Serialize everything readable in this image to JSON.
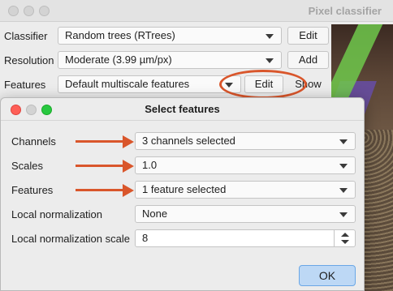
{
  "main": {
    "title": "Pixel classifier",
    "classifier": {
      "label": "Classifier",
      "value": "Random trees (RTrees)",
      "button": "Edit"
    },
    "resolution": {
      "label": "Resolution",
      "value": "Moderate (3.99 µm/px)",
      "button": "Add"
    },
    "features": {
      "label": "Features",
      "value": "Default multiscale features",
      "button": "Edit",
      "extra_button": "Show"
    }
  },
  "dialog": {
    "title": "Select features",
    "channels": {
      "label": "Channels",
      "value": "3 channels selected"
    },
    "scales": {
      "label": "Scales",
      "value": "1.0"
    },
    "features": {
      "label": "Features",
      "value": "1 feature selected"
    },
    "local_normalization": {
      "label": "Local normalization",
      "value": "None"
    },
    "local_normalization_scale": {
      "label": "Local normalization scale",
      "value": "8"
    },
    "ok": "OK"
  },
  "colors": {
    "annotation": "#d9562b",
    "ok_button": "#bdd8f5",
    "close": "#fe5f57",
    "zoom": "#28c840"
  }
}
